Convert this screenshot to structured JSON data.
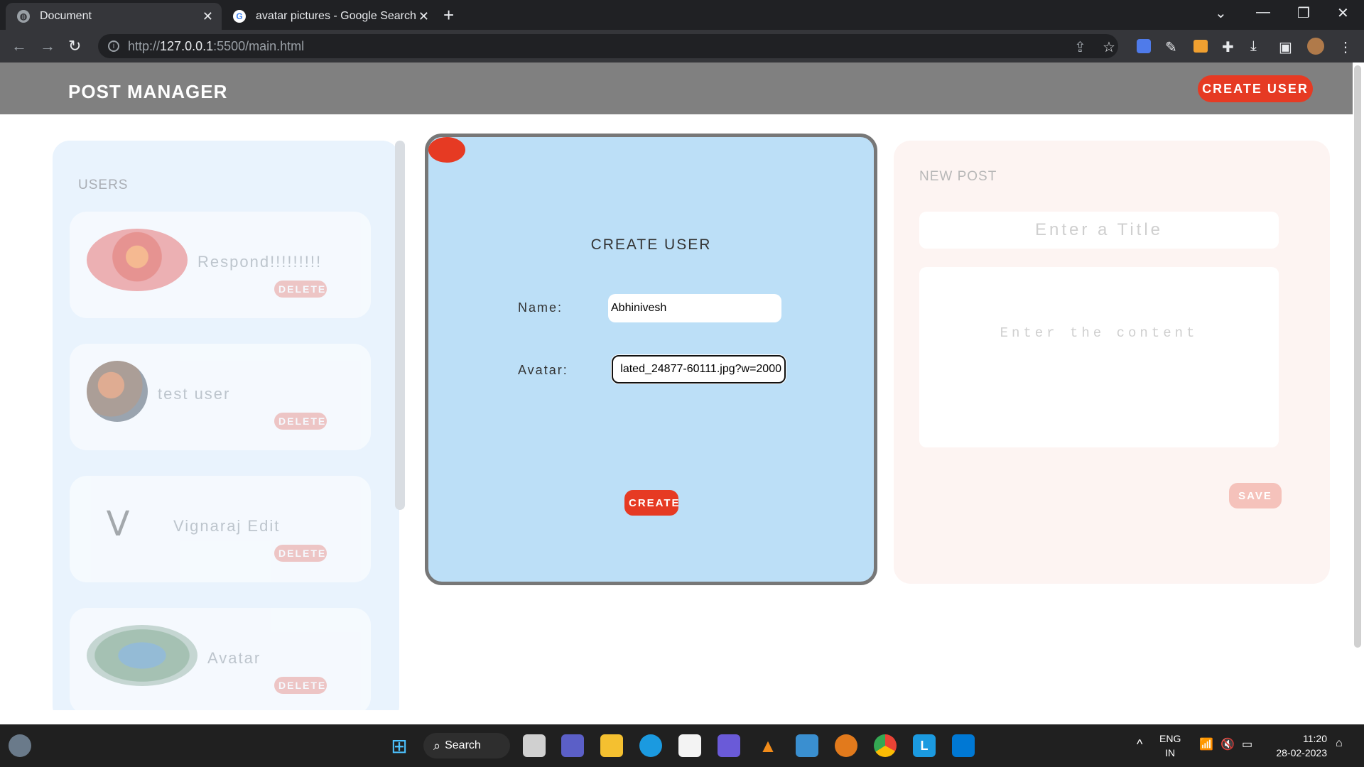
{
  "browser": {
    "tabs": [
      {
        "title": "Document",
        "active": true
      },
      {
        "title": "avatar pictures - Google Search",
        "active": false
      }
    ],
    "url_prefix": "http://",
    "url_host": "127.0.0.1",
    "url_rest": ":5500/main.html"
  },
  "header": {
    "title": "POST MANAGER",
    "create_user_label": "CREATE USER"
  },
  "users_panel": {
    "title": "USERS",
    "users": [
      {
        "name": "Respond!!!!!!!!!",
        "delete_label": "DELETE"
      },
      {
        "name": "test user",
        "delete_label": "DELETE"
      },
      {
        "name": "Vignaraj Edit",
        "delete_label": "DELETE"
      },
      {
        "name": "Avatar",
        "delete_label": "DELETE"
      }
    ]
  },
  "modal": {
    "title": "CREATE USER",
    "name_label": "Name:",
    "name_value": "Abhinivesh",
    "avatar_label": "Avatar:",
    "avatar_value": "lated_24877-60111.jpg?w=2000",
    "create_label": "CREATE"
  },
  "new_post": {
    "title": "NEW POST",
    "title_placeholder": "Enter a Title",
    "content_placeholder": "Enter the content",
    "save_label": "SAVE"
  },
  "taskbar": {
    "search_label": "Search",
    "lang": "ENG",
    "region": "IN",
    "time": "11:20",
    "date": "28-02-2023"
  },
  "colors": {
    "accent": "#e63a23",
    "modal_bg": "#bcdff7",
    "users_bg": "#e9f3fd",
    "post_bg": "#fdf4f2"
  }
}
